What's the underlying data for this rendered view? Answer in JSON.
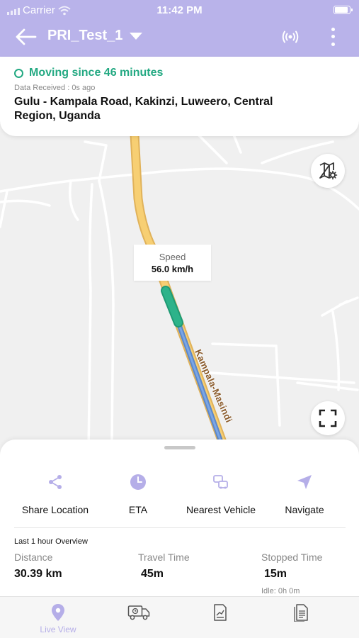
{
  "status_bar": {
    "carrier": "Carrier",
    "time": "11:42 PM"
  },
  "header": {
    "title": "PRI_Test_1"
  },
  "info": {
    "status": "Moving since 46 minutes",
    "received": "Data Received : 0s ago",
    "address": "Gulu - Kampala Road, Kakinzi, Luweero, Central Region, Uganda"
  },
  "map": {
    "speed_label": "Speed",
    "speed_value": "56.0 km/h",
    "road_name": "Kampala-Masindi"
  },
  "actions": [
    {
      "label": "Share Location",
      "icon": "share-icon"
    },
    {
      "label": "ETA",
      "icon": "clock-icon"
    },
    {
      "label": "Nearest Vehicle",
      "icon": "vehicles-icon"
    },
    {
      "label": "Navigate",
      "icon": "navigate-icon"
    }
  ],
  "overview": {
    "title": "Last 1 hour Overview",
    "distance": {
      "label": "Distance",
      "value": "30.39 km"
    },
    "travel_time": {
      "label": "Travel Time",
      "value": "45m"
    },
    "stopped_time": {
      "label": "Stopped Time",
      "value": "15m",
      "idle": "Idle: 0h 0m"
    }
  },
  "tabs": [
    {
      "label": "Live View",
      "icon": "location-pin-icon",
      "active": true
    },
    {
      "label": "",
      "icon": "truck-icon"
    },
    {
      "label": "",
      "icon": "report-icon"
    },
    {
      "label": "",
      "icon": "document-icon"
    }
  ],
  "colors": {
    "header": "#b9b3ea",
    "accent": "#b5aee8",
    "moving": "#23a982",
    "road": "#f5c86a",
    "track": "#2db38a"
  }
}
